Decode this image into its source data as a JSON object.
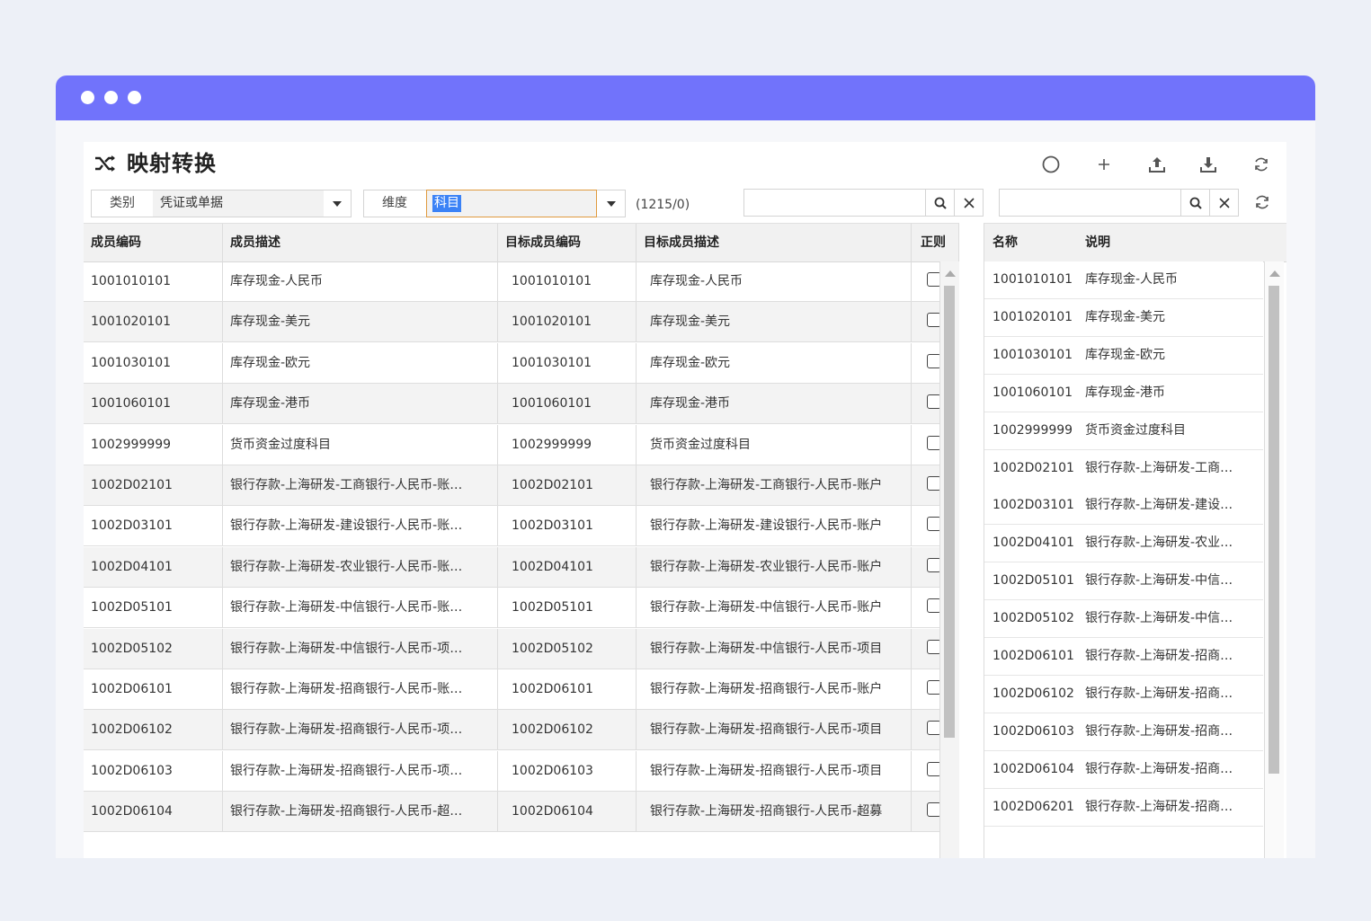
{
  "app": {
    "title": "映射转换"
  },
  "toolbar": {
    "icons": [
      "loading-circle-icon",
      "plus-icon",
      "upload-icon",
      "download-icon",
      "refresh-icon"
    ]
  },
  "filters": {
    "category_label": "类别",
    "category_value": "凭证或单据",
    "dimension_label": "维度",
    "dimension_value": "科目",
    "count": "(1215/0)",
    "search_left_value": "",
    "search_right_value": ""
  },
  "grid": {
    "columns": [
      "成员编码",
      "成员描述",
      "目标成员编码",
      "目标成员描述",
      "正则"
    ],
    "rows": [
      {
        "code": "1001010101",
        "desc": "库存现金-人民币",
        "tcode": "1001010101",
        "tdesc": "库存现金-人民币"
      },
      {
        "code": "1001020101",
        "desc": "库存现金-美元",
        "tcode": "1001020101",
        "tdesc": "库存现金-美元"
      },
      {
        "code": "1001030101",
        "desc": "库存现金-欧元",
        "tcode": "1001030101",
        "tdesc": "库存现金-欧元"
      },
      {
        "code": "1001060101",
        "desc": "库存现金-港币",
        "tcode": "1001060101",
        "tdesc": "库存现金-港币"
      },
      {
        "code": "1002999999",
        "desc": "货币资金过度科目",
        "tcode": "1002999999",
        "tdesc": "货币资金过度科目"
      },
      {
        "code": "1002D02101",
        "desc": "银行存款-上海研发-工商银行-人民币-账…",
        "tcode": "1002D02101",
        "tdesc": "银行存款-上海研发-工商银行-人民币-账户"
      },
      {
        "code": "1002D03101",
        "desc": "银行存款-上海研发-建设银行-人民币-账…",
        "tcode": "1002D03101",
        "tdesc": "银行存款-上海研发-建设银行-人民币-账户"
      },
      {
        "code": "1002D04101",
        "desc": "银行存款-上海研发-农业银行-人民币-账…",
        "tcode": "1002D04101",
        "tdesc": "银行存款-上海研发-农业银行-人民币-账户"
      },
      {
        "code": "1002D05101",
        "desc": "银行存款-上海研发-中信银行-人民币-账…",
        "tcode": "1002D05101",
        "tdesc": "银行存款-上海研发-中信银行-人民币-账户"
      },
      {
        "code": "1002D05102",
        "desc": "银行存款-上海研发-中信银行-人民币-项…",
        "tcode": "1002D05102",
        "tdesc": "银行存款-上海研发-中信银行-人民币-项目"
      },
      {
        "code": "1002D06101",
        "desc": "银行存款-上海研发-招商银行-人民币-账…",
        "tcode": "1002D06101",
        "tdesc": "银行存款-上海研发-招商银行-人民币-账户"
      },
      {
        "code": "1002D06102",
        "desc": "银行存款-上海研发-招商银行-人民币-项…",
        "tcode": "1002D06102",
        "tdesc": "银行存款-上海研发-招商银行-人民币-项目"
      },
      {
        "code": "1002D06103",
        "desc": "银行存款-上海研发-招商银行-人民币-项…",
        "tcode": "1002D06103",
        "tdesc": "银行存款-上海研发-招商银行-人民币-项目"
      },
      {
        "code": "1002D06104",
        "desc": "银行存款-上海研发-招商银行-人民币-超…",
        "tcode": "1002D06104",
        "tdesc": "银行存款-上海研发-招商银行-人民币-超募"
      }
    ]
  },
  "side": {
    "columns": [
      "名称",
      "说明"
    ],
    "rows": [
      {
        "name": "1001010101",
        "desc": "库存现金-人民币"
      },
      {
        "name": "1001020101",
        "desc": "库存现金-美元"
      },
      {
        "name": "1001030101",
        "desc": "库存现金-欧元"
      },
      {
        "name": "1001060101",
        "desc": "库存现金-港币"
      },
      {
        "name": "1002999999",
        "desc": "货币资金过度科目"
      },
      {
        "name": "1002D02101",
        "desc": "银行存款-上海研发-工商…"
      },
      {
        "name": "1002D03101",
        "desc": "银行存款-上海研发-建设…"
      },
      {
        "name": "1002D04101",
        "desc": "银行存款-上海研发-农业…"
      },
      {
        "name": "1002D05101",
        "desc": "银行存款-上海研发-中信…"
      },
      {
        "name": "1002D05102",
        "desc": "银行存款-上海研发-中信…"
      },
      {
        "name": "1002D06101",
        "desc": "银行存款-上海研发-招商…"
      },
      {
        "name": "1002D06102",
        "desc": "银行存款-上海研发-招商…"
      },
      {
        "name": "1002D06103",
        "desc": "银行存款-上海研发-招商…"
      },
      {
        "name": "1002D06104",
        "desc": "银行存款-上海研发-招商…"
      },
      {
        "name": "1002D06201",
        "desc": "银行存款-上海研发-招商…"
      }
    ]
  },
  "colors": {
    "titlebar": "#7173fb",
    "selection": "#3b82f6",
    "focus_border": "#e09a3e"
  }
}
